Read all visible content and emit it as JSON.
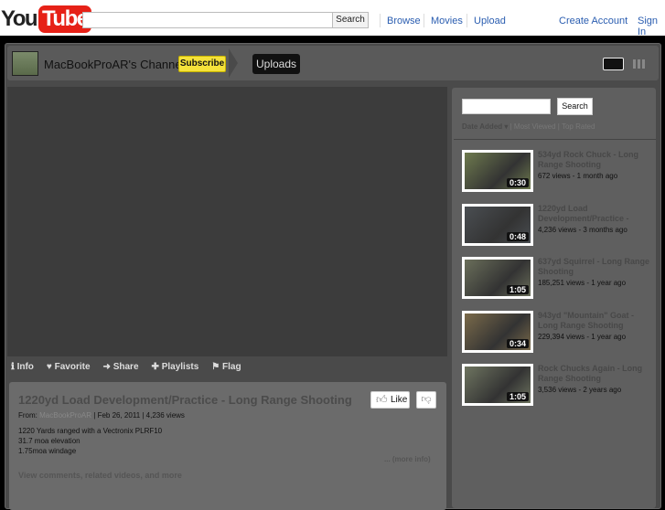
{
  "header": {
    "logo_you": "You",
    "logo_tube": "Tube",
    "search_button": "Search",
    "nav": [
      "Browse",
      "Movies",
      "Upload"
    ],
    "create_account": "Create Account",
    "sign_in": "Sign In"
  },
  "channel": {
    "name": "MacBookProAR's Channel",
    "subscribe": "Subscribe",
    "uploads": "Uploads"
  },
  "tabs": [
    {
      "icon": "info-icon",
      "glyph": "ℹ",
      "label": "Info"
    },
    {
      "icon": "heart-icon",
      "glyph": "♥",
      "label": "Favorite"
    },
    {
      "icon": "share-arrow-icon",
      "glyph": "➜",
      "label": "Share"
    },
    {
      "icon": "plus-icon",
      "glyph": "✚",
      "label": "Playlists"
    },
    {
      "icon": "flag-icon",
      "glyph": "⚑",
      "label": "Flag"
    }
  ],
  "video": {
    "title": "1220yd Load Development/Practice - Long Range Shooting",
    "like": "Like",
    "from_label": "From:",
    "author": "MacBookProAR",
    "date": "| Feb 26, 2011",
    "views": "| 4,236 views",
    "desc": [
      "1220 Yards ranged with a Vectronix PLRF10",
      "31.7 moa elevation",
      "1.75moa windage"
    ],
    "more_info": "... (more info)",
    "view_comments": "View comments, related videos, and more"
  },
  "sidebar": {
    "search_button": "Search",
    "sort": {
      "date": "Date Added ▾",
      "sep1": " | ",
      "viewed": "Most Viewed",
      "sep2": " | ",
      "rated": "Top Rated"
    },
    "items": [
      {
        "title": "534yd Rock Chuck - Long Range Shooting",
        "meta": "672 views - 1 month ago",
        "duration": "0:30",
        "color": "#6e7a4e"
      },
      {
        "title": "1220yd Load Development/Practice -",
        "meta": "4,236 views - 3 months ago",
        "duration": "0:48",
        "color": "#4a4e52"
      },
      {
        "title": "637yd Squirrel - Long Range Shooting",
        "meta": "185,251 views - 1 year ago",
        "duration": "1:05",
        "color": "#6a6e5a"
      },
      {
        "title": "943yd \"Mountain\" Goat - Long Range Shooting",
        "meta": "229,394 views - 1 year ago",
        "duration": "0:34",
        "color": "#7a6a4a"
      },
      {
        "title": "Rock Chucks Again - Long Range Shooting",
        "meta": "3,536 views - 2 years ago",
        "duration": "1:05",
        "color": "#6e7460"
      }
    ]
  }
}
